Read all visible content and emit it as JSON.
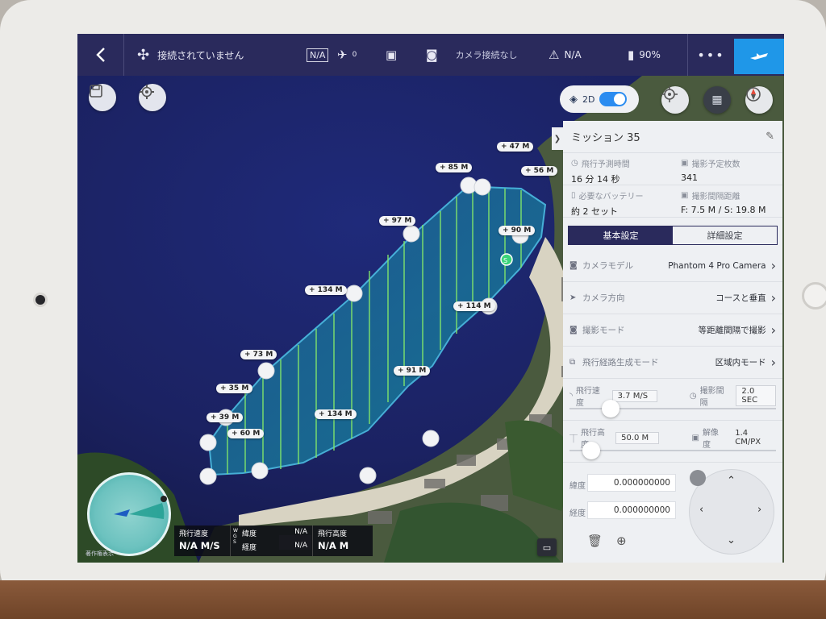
{
  "topbar": {
    "connection_status": "接続されていません",
    "gps_box": "N/A",
    "satellite_count": "0",
    "camera_status": "カメラ接続なし",
    "signal_value": "N/A",
    "battery_value": "90%",
    "more_label": "•••"
  },
  "map_controls": {
    "view_mode_label": "2D"
  },
  "mission": {
    "title": "ミッション 35",
    "flight_time_label": "飛行予測時間",
    "flight_time_value": "16 分 14 秒",
    "photos_label": "撮影予定枚数",
    "photos_value": "341",
    "battery_label": "必要なバッテリー",
    "battery_value": "約 2 セット",
    "interval_label": "撮影間隔距離",
    "interval_value": "F: 7.5 M / S: 19.8 M"
  },
  "tabs": {
    "basic": "基本設定",
    "advanced": "詳細設定"
  },
  "settings": [
    {
      "label": "カメラモデル",
      "value": "Phantom 4 Pro Camera"
    },
    {
      "label": "カメラ方向",
      "value": "コースと垂直"
    },
    {
      "label": "撮影モード",
      "value": "等距離間隔で撮影"
    },
    {
      "label": "飛行経路生成モード",
      "value": "区域内モード"
    }
  ],
  "sliders": {
    "speed_label": "飛行速度",
    "speed_value": "3.7 M/S",
    "shot_interval_label": "撮影間隔",
    "shot_interval_value": "2.0 SEC",
    "altitude_label": "飛行高度",
    "altitude_value": "50.0 M",
    "resolution_label": "解像度",
    "resolution_value": "1.4 CM/PX",
    "speed_level": 0.22,
    "altitude_level": 0.12
  },
  "coords": {
    "lat_label": "緯度",
    "lat_value": "0.000000000",
    "lon_label": "経度",
    "lon_value": "0.000000000"
  },
  "telemetry": {
    "speed_label": "飛行速度",
    "speed_value": "N/A M/S",
    "lat_label": "緯度",
    "lat_value": "N/A",
    "lon_label": "経度",
    "lon_value": "N/A",
    "altitude_label": "飛行高度",
    "altitude_value": "N/A M",
    "ws_label": "W G S"
  },
  "map_footer": "著作権表示",
  "distance_labels": [
    "47 M",
    "85 M",
    "56 M",
    "97 M",
    "90 M",
    "134 M",
    "114 M",
    "73 M",
    "91 M",
    "35 M",
    "134 M",
    "39 M",
    "60 M"
  ]
}
